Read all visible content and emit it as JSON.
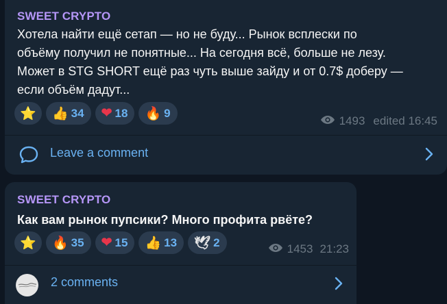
{
  "messages": [
    {
      "author": "SWEET CRYPTO",
      "text_lines": [
        "Хотела найти ещё сетап — но не буду... Рынок всплески по",
        "объёму получил не понятные... На сегодня всё, больше не лезу.",
        "Может в STG SHORT ещё раз чуть выше зайду и от 0.7$ доберу —",
        "если объём дадут..."
      ],
      "reactions": [
        {
          "icon": "star-icon",
          "emoji": "⭐",
          "count": ""
        },
        {
          "icon": "thumbs-up-icon",
          "emoji": "👍",
          "count": "34"
        },
        {
          "icon": "heart-icon",
          "emoji": "❤",
          "count": "18"
        },
        {
          "icon": "fire-icon",
          "emoji": "🔥",
          "count": "9"
        }
      ],
      "views": "1493",
      "time": "edited 16:45",
      "comments_label": "Leave a comment"
    },
    {
      "author": "SWEET CRYPTO",
      "text_lines": [
        "Как вам рынок пупсики? Много профита рвёте?"
      ],
      "reactions": [
        {
          "icon": "star-icon",
          "emoji": "⭐",
          "count": ""
        },
        {
          "icon": "fire-icon",
          "emoji": "🔥",
          "count": "35"
        },
        {
          "icon": "heart-icon",
          "emoji": "❤",
          "count": "15"
        },
        {
          "icon": "thumbs-up-icon",
          "emoji": "👍",
          "count": "13"
        },
        {
          "icon": "dove-icon",
          "emoji": "🕊",
          "count": "2"
        }
      ],
      "views": "1453",
      "time": "21:23",
      "comments_label": "2 comments"
    }
  ],
  "colors": {
    "background": "#0e1621",
    "bubble": "#182533",
    "author": "#b596f7",
    "accent": "#6ab2f2",
    "meta": "#6c7883"
  }
}
